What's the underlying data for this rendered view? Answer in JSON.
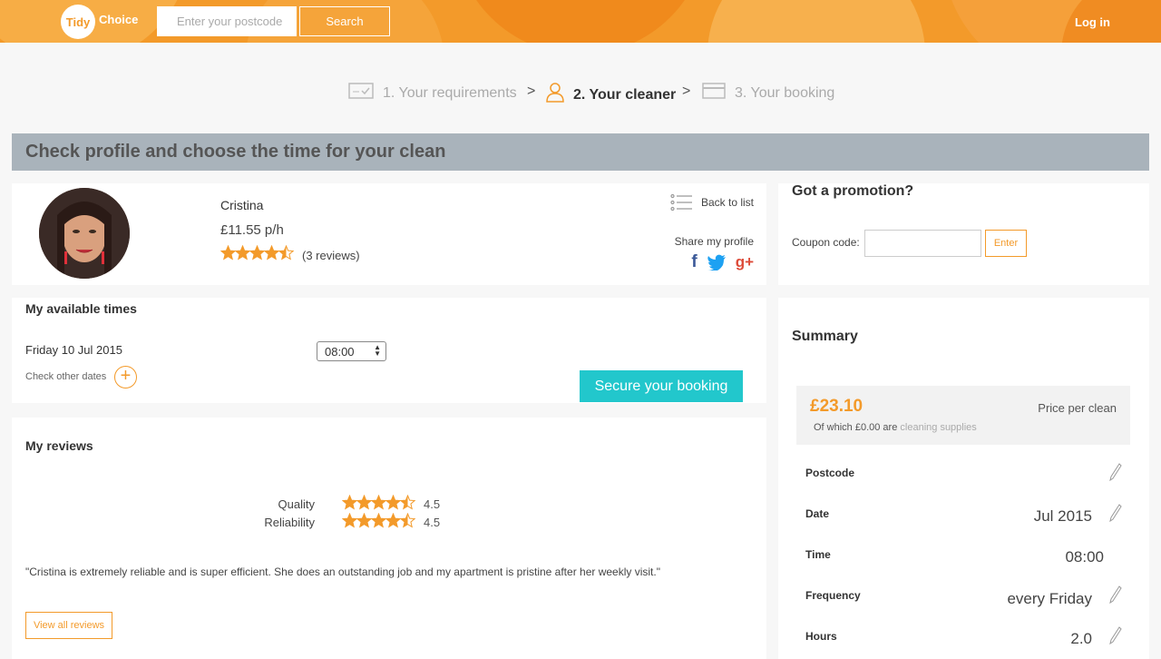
{
  "header": {
    "logo_badge": "Tidy",
    "logo_text": "Choice",
    "postcode_placeholder": "Enter your postcode",
    "search_label": "Search",
    "login_label": "Log in"
  },
  "steps": [
    {
      "label": "1. Your requirements"
    },
    {
      "label": "2. Your cleaner"
    },
    {
      "label": "3. Your booking"
    }
  ],
  "step_separator": ">",
  "page_title": "Check profile and choose the time for your clean",
  "profile": {
    "name": "Cristina",
    "rate": "£11.55 p/h",
    "rating": 4.5,
    "reviews": "(3 reviews)",
    "back_label": "Back to list",
    "share_label": "Share my profile",
    "social": {
      "facebook": "f",
      "twitter": "twitter-bird-icon",
      "google": "g+"
    }
  },
  "promotion": {
    "title": "Got a promotion?",
    "coupon_label": "Coupon code:",
    "enter_label": "Enter"
  },
  "availability": {
    "title": "My available times",
    "date": "Friday 10 Jul 2015",
    "time": "08:00",
    "check_other": "Check other dates",
    "secure_label": "Secure your booking"
  },
  "reviews": {
    "title": "My reviews",
    "ratings": [
      {
        "label": "Quality",
        "value": 4.5,
        "score": "4.5"
      },
      {
        "label": "Reliability",
        "value": 4.5,
        "score": "4.5"
      }
    ],
    "quote": "\"Cristina is extremely reliable and is super efficient. She does an outstanding job and my apartment is pristine after her weekly visit.\"",
    "view_all_label": "View all reviews"
  },
  "summary": {
    "title": "Summary",
    "price": "£23.10",
    "price_label": "Price per clean",
    "supplies_prefix": "Of which £0.00 are",
    "supplies_link": "cleaning supplies",
    "rows": [
      {
        "label": "Postcode",
        "value": ""
      },
      {
        "label": "Date",
        "value": "Jul 2015"
      },
      {
        "label": "Time",
        "value": "08:00"
      },
      {
        "label": "Frequency",
        "value": "every Friday"
      },
      {
        "label": "Hours",
        "value": "2.0"
      }
    ]
  },
  "colors": {
    "accent": "#f39a2a",
    "teal": "#22c7cc",
    "titlebar": "#a9b3bb"
  }
}
